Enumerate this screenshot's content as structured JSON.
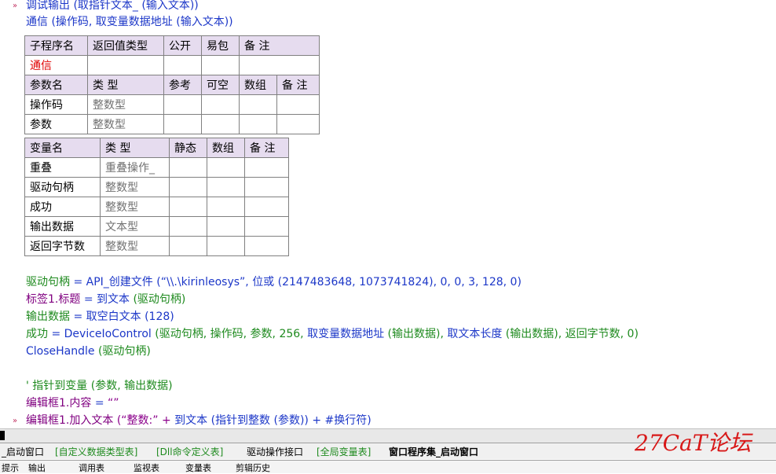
{
  "top": {
    "line1": "调试输出 (取指针文本_ (输入文本))",
    "line2": "通信 (操作码, 取变量数据地址 (输入文本))"
  },
  "sub_table": {
    "headers": [
      "子程序名",
      "返回值类型",
      "公开",
      "易包",
      "备 注"
    ],
    "name": "通信"
  },
  "param_table": {
    "headers": [
      "参数名",
      "类 型",
      "参考",
      "可空",
      "数组",
      "备 注"
    ],
    "rows": [
      {
        "name": "操作码",
        "type": "整数型"
      },
      {
        "name": "参数",
        "type": "整数型"
      }
    ]
  },
  "var_table": {
    "headers": [
      "变量名",
      "类 型",
      "静态",
      "数组",
      "备 注"
    ],
    "rows": [
      {
        "name": "重叠",
        "type": "重叠操作_"
      },
      {
        "name": "驱动句柄",
        "type": "整数型"
      },
      {
        "name": "成功",
        "type": "整数型"
      },
      {
        "name": "输出数据",
        "type": "文本型"
      },
      {
        "name": "返回字节数",
        "type": "整数型"
      }
    ]
  },
  "code": {
    "l1a": "驱动句柄",
    "l1b": " = ",
    "l1c": "API_创建文件",
    "l1d": " (“\\\\.\\kirinleosys”, ",
    "l1e": "位或",
    "l1f": " (2147483648, 1073741824), 0, 0, 3, 128, 0)",
    "l2a": "标签1",
    "l2b": ".标题",
    "l2c": " = ",
    "l2d": "到文本",
    "l2e": " (驱动句柄)",
    "l3a": "输出数据",
    "l3b": " = ",
    "l3c": "取空白文本",
    "l3d": " (128)",
    "l4a": "成功",
    "l4b": " = ",
    "l4c": "DeviceIoControl",
    "l4d": " (驱动句柄, 操作码, 参数, 256, ",
    "l4e": "取变量数据地址",
    "l4f": " (输出数据), ",
    "l4g": "取文本长度",
    "l4h": " (输出数据), 返回字节数, 0)",
    "l5a": "CloseHandle",
    "l5b": " (驱动句柄)",
    "l6": "' 指针到变量 (参数, 输出数据)",
    "l7a": "编辑框1",
    "l7b": ".内容",
    "l7c": " = ",
    "l7d": "“”",
    "l8a": "编辑框1",
    "l8b": ".加入文本",
    "l8c": " (“整数:” + ",
    "l8d": "到文本",
    "l8e": " (",
    "l8f": "指针到整数",
    "l8g": " (参数)) + #换行符)"
  },
  "tabs": [
    {
      "label": "_启动窗口",
      "kind": "b"
    },
    {
      "label": "[自定义数据类型表]",
      "kind": "g"
    },
    {
      "label": "[Dll命令定义表]",
      "kind": "g"
    },
    {
      "label": "驱动操作接口",
      "kind": "b"
    },
    {
      "label": "[全局变量表]",
      "kind": "g"
    },
    {
      "label": "窗口程序集_启动窗口",
      "kind": "active"
    }
  ],
  "bottom_items": [
    "提示",
    "输出",
    "调用表",
    "监视表",
    "变量表",
    "剪辑历史"
  ],
  "watermark": "27CaT论坛"
}
